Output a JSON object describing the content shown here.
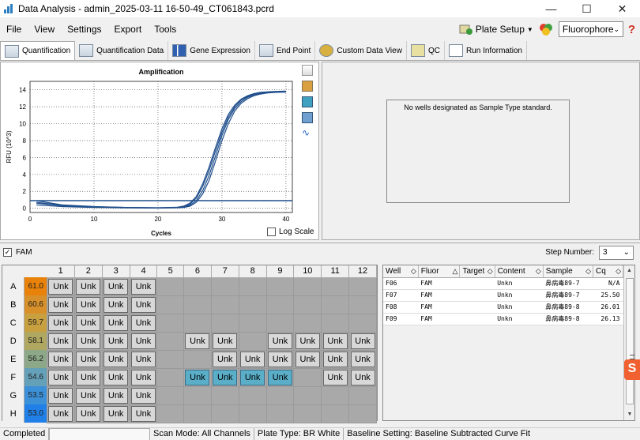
{
  "window": {
    "title": "Data Analysis - admin_2025-03-11 16-50-49_CT061843.pcrd",
    "minimize": "—",
    "maximize": "☐",
    "close": "✕"
  },
  "menu": {
    "items": [
      "File",
      "View",
      "Settings",
      "Export",
      "Tools"
    ],
    "plate_setup": "Plate Setup",
    "fluorophore": "Fluorophore",
    "help": "?"
  },
  "tabs": [
    "Quantification",
    "Quantification Data",
    "Gene Expression",
    "End Point",
    "Custom Data View",
    "QC",
    "Run Information"
  ],
  "chart": {
    "log_scale_label": "Log Scale",
    "log_scale_checked": false
  },
  "chart_data": {
    "type": "line",
    "title": "Amplification",
    "xlabel": "Cycles",
    "ylabel": "RFU (10^3)",
    "xlim": [
      0,
      41
    ],
    "ylim": [
      -0.5,
      15
    ],
    "xticks": [
      0,
      10,
      20,
      30,
      40
    ],
    "yticks": [
      0,
      2,
      4,
      6,
      8,
      10,
      12,
      14
    ],
    "grid": true,
    "threshold": 0.9,
    "series": [
      {
        "values": [
          [
            1,
            0.6
          ],
          [
            5,
            0.3
          ],
          [
            10,
            0.15
          ],
          [
            15,
            0.08
          ],
          [
            20,
            0.05
          ],
          [
            23,
            0.1
          ],
          [
            24,
            0.2
          ],
          [
            25,
            0.5
          ],
          [
            26,
            1.2
          ],
          [
            27,
            2.6
          ],
          [
            28,
            4.5
          ],
          [
            29,
            6.8
          ],
          [
            30,
            9.0
          ],
          [
            31,
            10.8
          ],
          [
            32,
            12.0
          ],
          [
            33,
            12.8
          ],
          [
            34,
            13.2
          ],
          [
            35,
            13.5
          ],
          [
            36,
            13.65
          ],
          [
            37,
            13.72
          ],
          [
            38,
            13.76
          ],
          [
            39,
            13.78
          ],
          [
            40,
            13.8
          ]
        ]
      },
      {
        "values": [
          [
            1,
            0.9
          ],
          [
            5,
            0.4
          ],
          [
            10,
            0.2
          ],
          [
            15,
            0.1
          ],
          [
            20,
            0.05
          ],
          [
            23,
            0.08
          ],
          [
            24,
            0.15
          ],
          [
            25,
            0.35
          ],
          [
            26,
            0.9
          ],
          [
            27,
            2.1
          ],
          [
            28,
            3.9
          ],
          [
            29,
            6.2
          ],
          [
            30,
            8.6
          ],
          [
            31,
            10.5
          ],
          [
            32,
            11.8
          ],
          [
            33,
            12.6
          ],
          [
            34,
            13.1
          ],
          [
            35,
            13.4
          ],
          [
            36,
            13.55
          ],
          [
            37,
            13.65
          ],
          [
            38,
            13.7
          ],
          [
            39,
            13.72
          ],
          [
            40,
            13.75
          ]
        ]
      },
      {
        "values": [
          [
            1,
            0.4
          ],
          [
            5,
            0.2
          ],
          [
            10,
            0.1
          ],
          [
            15,
            0.05
          ],
          [
            20,
            0.02
          ],
          [
            23,
            0.06
          ],
          [
            24,
            0.1
          ],
          [
            25,
            0.25
          ],
          [
            26,
            0.7
          ],
          [
            27,
            1.7
          ],
          [
            28,
            3.3
          ],
          [
            29,
            5.6
          ],
          [
            30,
            8.0
          ],
          [
            31,
            10.0
          ],
          [
            32,
            11.5
          ],
          [
            33,
            12.4
          ],
          [
            34,
            12.95
          ],
          [
            35,
            13.3
          ],
          [
            36,
            13.5
          ],
          [
            37,
            13.62
          ],
          [
            38,
            13.68
          ],
          [
            39,
            13.72
          ],
          [
            40,
            13.74
          ]
        ]
      },
      {
        "values": [
          [
            1,
            0.7
          ],
          [
            5,
            0.35
          ],
          [
            10,
            0.18
          ],
          [
            15,
            0.1
          ],
          [
            20,
            0.06
          ],
          [
            23,
            0.12
          ],
          [
            24,
            0.25
          ],
          [
            25,
            0.6
          ],
          [
            26,
            1.4
          ],
          [
            27,
            2.9
          ],
          [
            28,
            4.9
          ],
          [
            29,
            7.2
          ],
          [
            30,
            9.4
          ],
          [
            31,
            11.1
          ],
          [
            32,
            12.2
          ],
          [
            33,
            12.9
          ],
          [
            34,
            13.3
          ],
          [
            35,
            13.55
          ],
          [
            36,
            13.7
          ],
          [
            37,
            13.76
          ],
          [
            38,
            13.8
          ],
          [
            39,
            13.82
          ],
          [
            40,
            13.84
          ]
        ]
      }
    ],
    "color": "#1f4e8c"
  },
  "standard_panel": {
    "message": "No wells designated as Sample Type standard."
  },
  "fam_bar": {
    "label": "FAM",
    "checked": true,
    "step_label": "Step Number:",
    "step_value": "3"
  },
  "plate": {
    "columns": [
      "1",
      "2",
      "3",
      "4",
      "5",
      "6",
      "7",
      "8",
      "9",
      "10",
      "11",
      "12"
    ],
    "rows": [
      {
        "label": "A",
        "temp": "61.0",
        "color": "#e8820a",
        "wells": [
          "Unk",
          "Unk",
          "Unk",
          "Unk",
          "",
          "",
          "",
          "",
          "",
          "",
          "",
          ""
        ]
      },
      {
        "label": "B",
        "temp": "60.6",
        "color": "#d8902a",
        "wells": [
          "Unk",
          "Unk",
          "Unk",
          "Unk",
          "",
          "",
          "",
          "",
          "",
          "",
          "",
          ""
        ]
      },
      {
        "label": "C",
        "temp": "59.7",
        "color": "#c8a040",
        "wells": [
          "Unk",
          "Unk",
          "Unk",
          "Unk",
          "",
          "",
          "",
          "",
          "",
          "",
          "",
          ""
        ]
      },
      {
        "label": "D",
        "temp": "58.1",
        "color": "#b0a860",
        "wells": [
          "Unk",
          "Unk",
          "Unk",
          "Unk",
          "",
          "Unk",
          "Unk",
          "",
          "Unk",
          "Unk",
          "Unk",
          "Unk"
        ]
      },
      {
        "label": "E",
        "temp": "56.2",
        "color": "#8ca888",
        "wells": [
          "Unk",
          "Unk",
          "Unk",
          "Unk",
          "",
          "",
          "Unk",
          "Unk",
          "Unk",
          "Unk",
          "Unk",
          "Unk"
        ]
      },
      {
        "label": "F",
        "temp": "54.6",
        "color": "#64a0b8",
        "wells": [
          "Unk",
          "Unk",
          "Unk",
          "Unk",
          "",
          "Unk*",
          "Unk*",
          "Unk*",
          "Unk*",
          "",
          "Unk",
          "Unk"
        ]
      },
      {
        "label": "G",
        "temp": "53.5",
        "color": "#3c90d8",
        "wells": [
          "Unk",
          "Unk",
          "Unk",
          "Unk",
          "",
          "",
          "",
          "",
          "",
          "",
          "",
          ""
        ]
      },
      {
        "label": "H",
        "temp": "53.0",
        "color": "#2080e8",
        "wells": [
          "Unk",
          "Unk",
          "Unk",
          "Unk",
          "",
          "",
          "",
          "",
          "",
          "",
          "",
          ""
        ]
      }
    ]
  },
  "results": {
    "headers": [
      "Well",
      "Fluor",
      "Target",
      "Content",
      "Sample",
      "Cq"
    ],
    "rows": [
      {
        "well": "F06",
        "fluor": "FAM",
        "target": "",
        "content": "Unkn",
        "sample": "鼻病毒89-7",
        "cq": "N/A"
      },
      {
        "well": "F07",
        "fluor": "FAM",
        "target": "",
        "content": "Unkn",
        "sample": "鼻病毒89-7",
        "cq": "25.50"
      },
      {
        "well": "F08",
        "fluor": "FAM",
        "target": "",
        "content": "Unkn",
        "sample": "鼻病毒89-8",
        "cq": "26.01"
      },
      {
        "well": "F09",
        "fluor": "FAM",
        "target": "",
        "content": "Unkn",
        "sample": "鼻病毒89-8",
        "cq": "26.13"
      }
    ]
  },
  "status": {
    "state": "Completed",
    "scan_mode": "Scan Mode: All Channels",
    "plate_type": "Plate Type: BR White",
    "baseline": "Baseline Setting: Baseline Subtracted Curve Fit"
  },
  "overlay_badge": "S"
}
